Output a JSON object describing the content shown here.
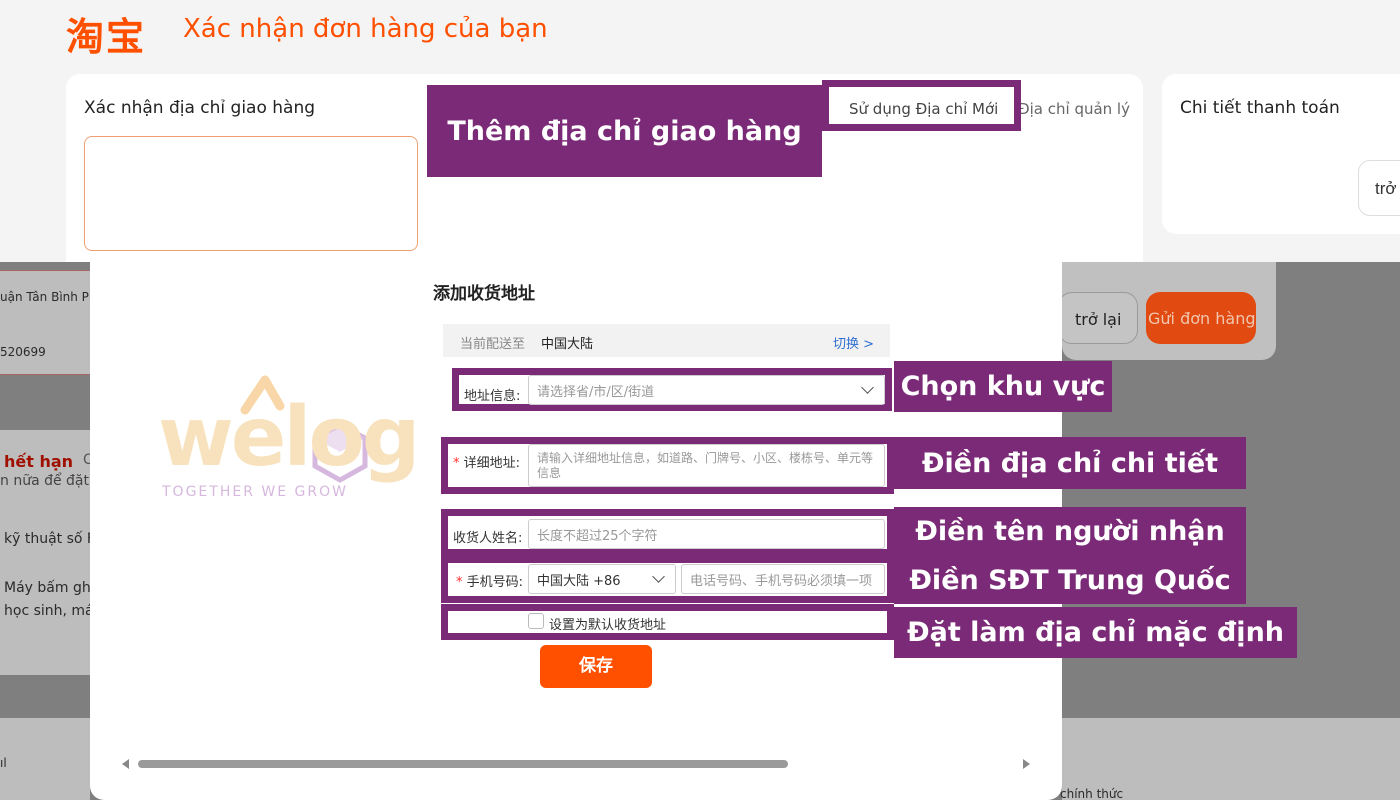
{
  "header": {
    "logo": "淘宝",
    "title": "Xác nhận đơn hàng của bạn"
  },
  "address_card": {
    "title": "Xác nhận địa chỉ giao hàng",
    "use_new_address": "Sử dụng Địa chỉ Mới",
    "manage_address": "Địa chỉ quản lý"
  },
  "payment_card": {
    "title": "Chi tiết thanh toán",
    "back_partial": "trở"
  },
  "background": {
    "addr_partial": "uận Tân Bình Phư",
    "phone_partial": "520699",
    "expired": "hết hạn",
    "expired_suffix": "C",
    "more_partial": "n nữa để đặt l",
    "tech_partial": "kỹ thuật số F",
    "item_line1": "Máy bấm gh",
    "item_line2": "học sinh, má",
    "left_edge": "ıl",
    "official_partial": "chính thức",
    "back_button": "trở lại",
    "send_button": "Gửi đơn hàng"
  },
  "modal": {
    "title": "添加收货地址",
    "ship_to_label": "当前配送至",
    "ship_to_value": "中国大陆",
    "switch_link": "切换 >",
    "region_label": "地址信息:",
    "region_placeholder": "请选择省/市/区/街道",
    "detail_label": "详细地址:",
    "detail_placeholder": "请输入详细地址信息，如道路、门牌号、小区、楼栋号、单元等信息",
    "name_label": "收货人姓名:",
    "name_placeholder": "长度不超过25个字符",
    "phone_label": "手机号码:",
    "country_code": "中国大陆 +86",
    "phone_placeholder": "电话号码、手机号码必须填一项",
    "default_checkbox_label": "设置为默认收货地址",
    "save_button": "保存"
  },
  "annotations": {
    "add_address": "Thêm địa chỉ giao hàng",
    "choose_region": "Chọn khu vực",
    "fill_detail": "Điền địa chỉ chi tiết",
    "fill_name": "Điền tên người nhận",
    "fill_phone": "Điền SĐT Trung Quốc",
    "set_default": "Đặt làm địa chỉ mặc định"
  },
  "watermark": {
    "brand": "welog",
    "slogan": "TOGETHER WE GROW"
  },
  "colors": {
    "brand_orange": "#ff5000",
    "annotation_purple": "#7b2a77",
    "link_blue": "#2f6fd0"
  }
}
